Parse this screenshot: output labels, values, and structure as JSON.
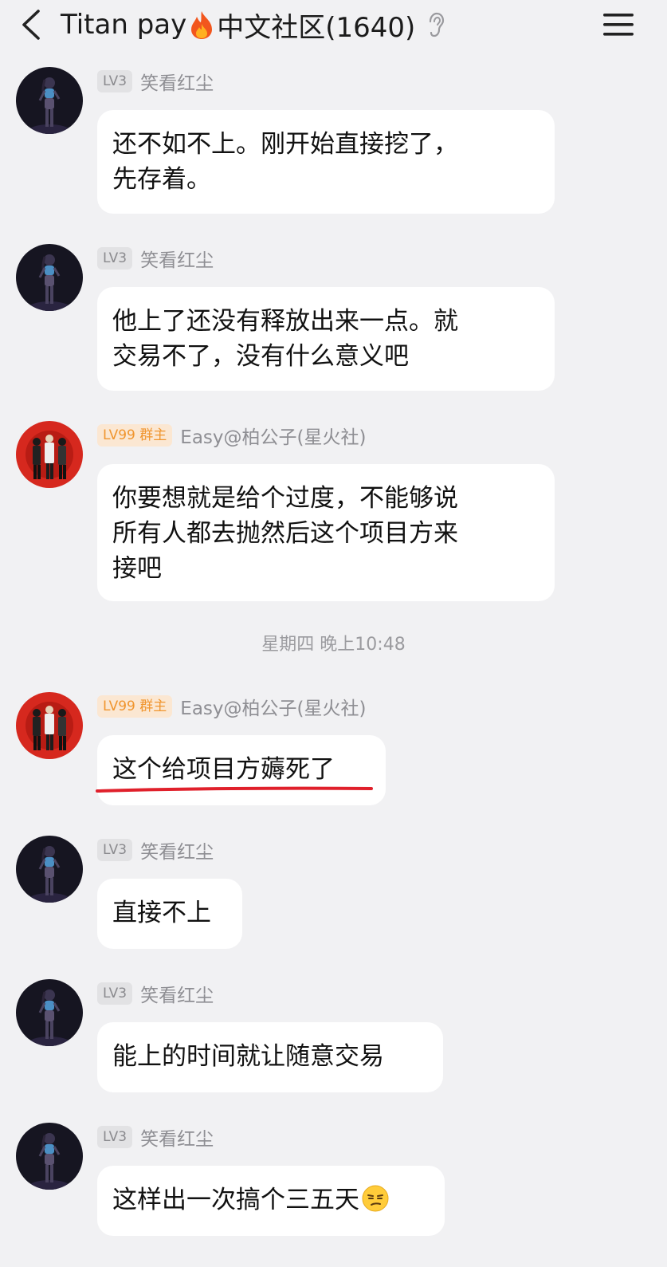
{
  "header": {
    "title_prefix": "Titan pay",
    "title_suffix": "中文社区(1640)",
    "back_icon": "chevron-left-icon",
    "fire_icon": "fire-emoji",
    "ear_icon": "ear-icon",
    "menu_icon": "hamburger-menu-icon"
  },
  "users": {
    "a": {
      "level": "LV3",
      "name": "笑看红尘"
    },
    "b": {
      "level": "LV99",
      "role": "群主",
      "name": "Easy@柏公子(星火社)"
    }
  },
  "messages": [
    {
      "lines": [
        "还不如不上。刚开始直接挖了，",
        "先存着。"
      ]
    },
    {
      "lines": [
        "他上了还没有释放出来一点。就",
        "交易不了，没有什么意义吧"
      ]
    },
    {
      "lines": [
        "你要想就是给个过度，不能够说",
        "所有人都去抛然后这个项目方来",
        "接吧"
      ]
    },
    {
      "lines": [
        "这个给项目方薅死了"
      ]
    },
    {
      "lines": [
        "直接不上"
      ]
    },
    {
      "lines": [
        "能上的时间就让随意交易"
      ]
    },
    {
      "lines": [
        "这样出一次搞个三五天"
      ]
    }
  ],
  "timestamp": "星期四 晚上10:48",
  "colors": {
    "background": "#f1f1f3",
    "bubble": "#ffffff",
    "owner_badge_text": "#f0952e",
    "owner_badge_bg": "#fbe7d2",
    "underline_annotation": "#e0202b"
  }
}
